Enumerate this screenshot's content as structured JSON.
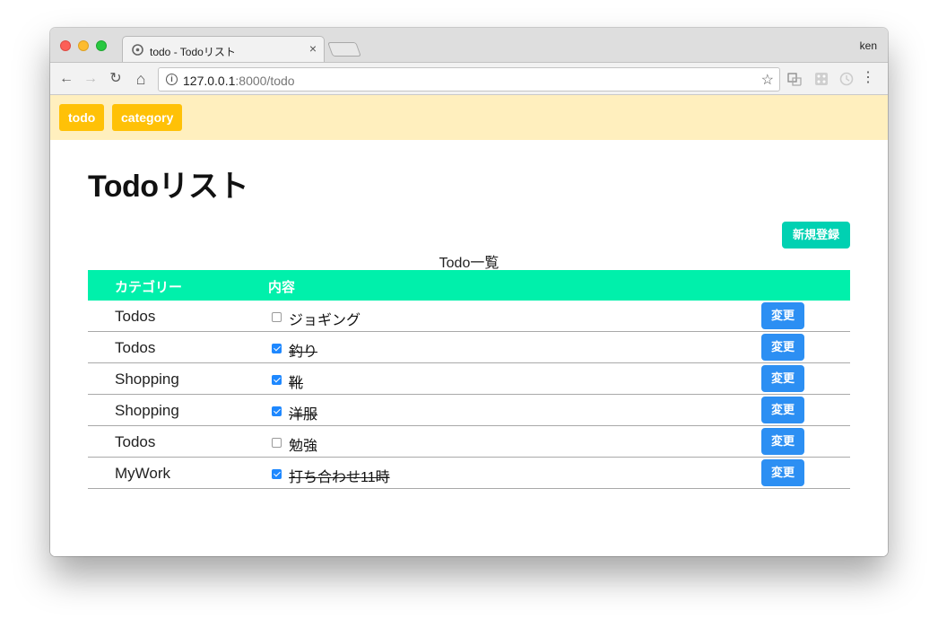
{
  "browser": {
    "tab_title": "todo - Todoリスト",
    "tab_close": "×",
    "profile_name": "ken",
    "url_host": "127.0.0.1",
    "url_path": ":8000/todo",
    "nav": {
      "back": "←",
      "forward": "→",
      "reload": "↻",
      "home": "⌂"
    },
    "star": "☆",
    "menu": "⋮"
  },
  "navbar": {
    "items": [
      "todo",
      "category"
    ],
    "color": "#ffc107"
  },
  "page": {
    "title": "Todoリスト",
    "new_button": "新規登録",
    "caption": "Todo一覧"
  },
  "table": {
    "headers": {
      "category": "カテゴリー",
      "content": "内容"
    },
    "edit_label": "変更",
    "rows": [
      {
        "category": "Todos",
        "content": "ジョギング",
        "done": false
      },
      {
        "category": "Todos",
        "content": "釣り",
        "done": true
      },
      {
        "category": "Shopping",
        "content": "靴",
        "done": true
      },
      {
        "category": "Shopping",
        "content": "洋服",
        "done": true
      },
      {
        "category": "Todos",
        "content": "勉強",
        "done": false
      },
      {
        "category": "MyWork",
        "content": "打ち合わせ11時",
        "done": true
      }
    ]
  },
  "colors": {
    "accent_teal": "#00d1b2",
    "header_green": "#00f0ab",
    "edit_blue": "#2c8ff3",
    "navbar_bg": "#ffefbe"
  }
}
